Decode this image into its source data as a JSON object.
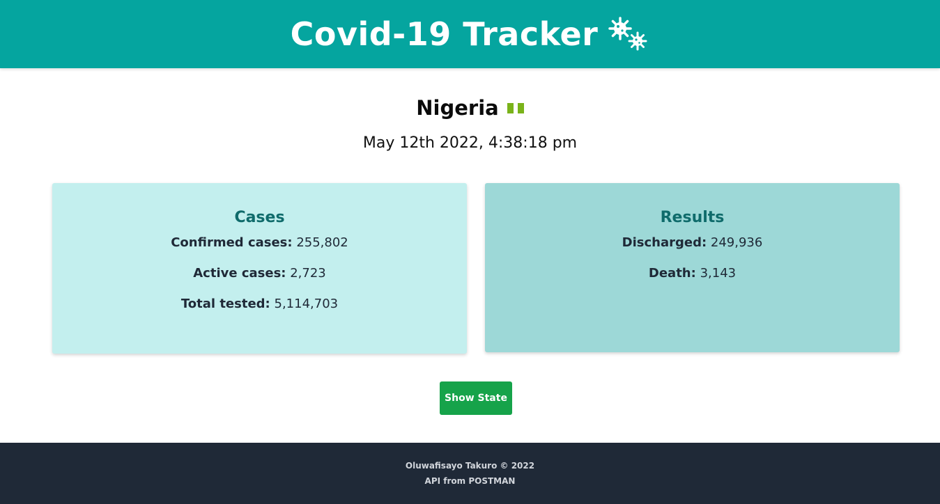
{
  "header": {
    "title": "Covid-19 Tracker",
    "icon": "virus-icon"
  },
  "country": {
    "name": "Nigeria",
    "flag_icon": "nigeria-flag-icon",
    "flag_color": "#7ab31a"
  },
  "updated": "May 12th 2022, 4:38:18 pm",
  "cases": {
    "title": "Cases",
    "confirmed_label": "Confirmed cases:",
    "confirmed_value": "255,802",
    "active_label": "Active cases:",
    "active_value": "2,723",
    "tested_label": "Total tested:",
    "tested_value": "5,114,703"
  },
  "results": {
    "title": "Results",
    "discharged_label": "Discharged:",
    "discharged_value": "249,936",
    "death_label": "Death:",
    "death_value": "3,143"
  },
  "show_state_label": "Show State",
  "footer": {
    "credit": "Oluwafisayo Takuro © 2022",
    "api": "API from POSTMAN"
  },
  "colors": {
    "header": "#05a59f",
    "cases_card": "#c3efee",
    "results_card": "#9dd8d7",
    "button": "#16a34a",
    "footer": "#1f2937"
  }
}
